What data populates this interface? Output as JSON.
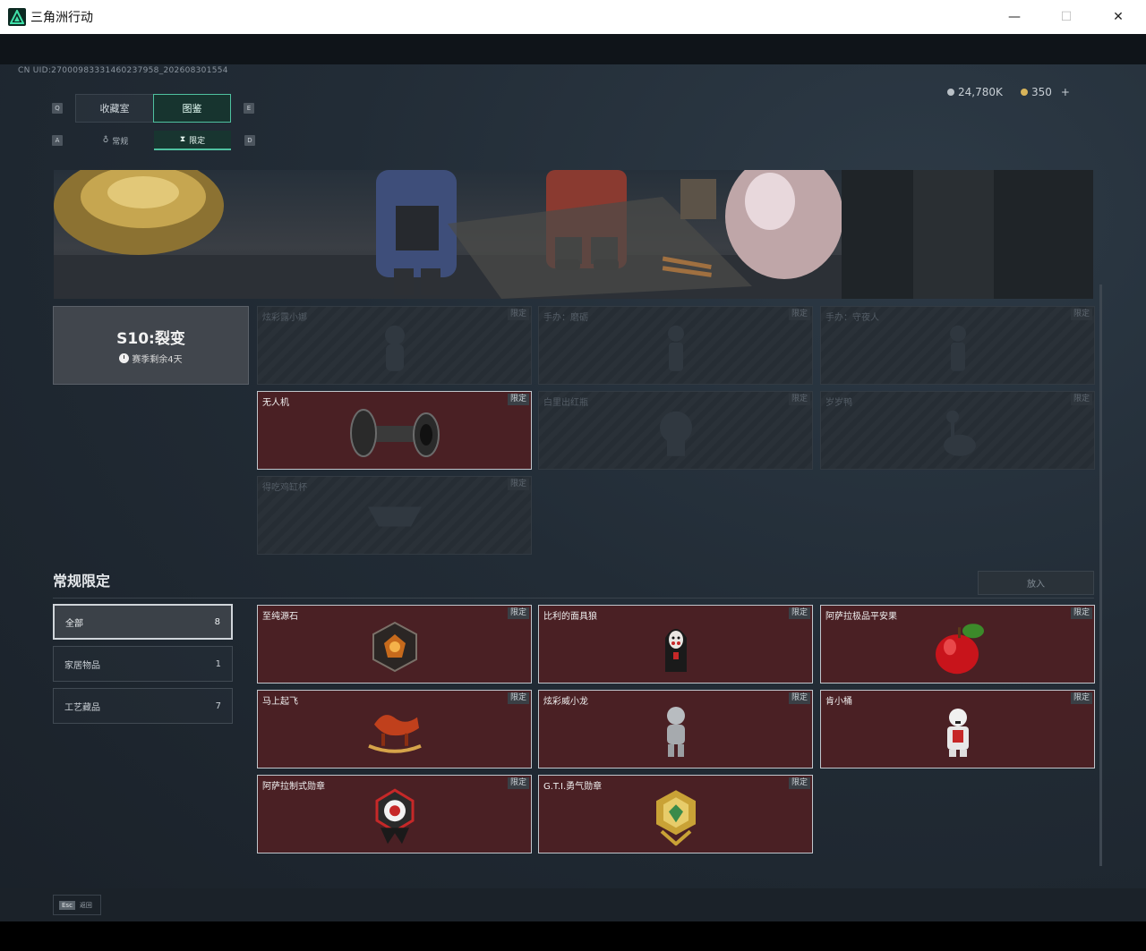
{
  "window": {
    "title": "三角洲行动",
    "minimize": "—",
    "maximize": "☐",
    "close": "✕"
  },
  "uid": "CN UID:27000983331460237958_202608301554",
  "nav": {
    "key_q": "Q",
    "key_e": "E",
    "key_a": "A",
    "key_d": "D",
    "tabs": [
      {
        "label": "收藏室"
      },
      {
        "label": "图鉴"
      }
    ],
    "subtabs": [
      {
        "label": "常规"
      },
      {
        "label": "限定"
      }
    ]
  },
  "currency": {
    "silver": "24,780K",
    "gold": "350",
    "plus": "+"
  },
  "season": {
    "name": "S10:裂变",
    "remaining": "赛季剩余4天"
  },
  "season_items": [
    {
      "name": "炫彩露小娜",
      "tag": "限定",
      "owned": false
    },
    {
      "name": "手办：磨砺",
      "tag": "限定",
      "owned": false
    },
    {
      "name": "手办：守夜人",
      "tag": "限定",
      "owned": false
    },
    {
      "name": "无人机",
      "tag": "限定",
      "owned": true
    },
    {
      "name": "白里出红瓶",
      "tag": "限定",
      "owned": false
    },
    {
      "name": "岁岁鸭",
      "tag": "限定",
      "owned": false
    },
    {
      "name": "得吃鸡缸杯",
      "tag": "限定",
      "owned": false
    }
  ],
  "section": {
    "title": "常规限定",
    "collapse": "放入"
  },
  "categories": [
    {
      "label": "全部",
      "count": "8"
    },
    {
      "label": "家居物品",
      "count": "1"
    },
    {
      "label": "工艺藏品",
      "count": "7"
    }
  ],
  "regular_items": [
    {
      "name": "至纯源石",
      "tag": "限定"
    },
    {
      "name": "比利的面具狼",
      "tag": "限定"
    },
    {
      "name": "阿萨拉极品平安果",
      "tag": "限定"
    },
    {
      "name": "马上起飞",
      "tag": "限定"
    },
    {
      "name": "炫彩威小龙",
      "tag": "限定"
    },
    {
      "name": "肯小桶",
      "tag": "限定"
    },
    {
      "name": "阿萨拉制式勋章",
      "tag": "限定"
    },
    {
      "name": "G.T.I.勇气勋章",
      "tag": "限定"
    }
  ],
  "footer": {
    "esc_key": "Esc",
    "back": "返回"
  },
  "colors": {
    "accent": "#4fc1a0",
    "owned_card": "#4a2024",
    "locked_card": "#262d34"
  }
}
